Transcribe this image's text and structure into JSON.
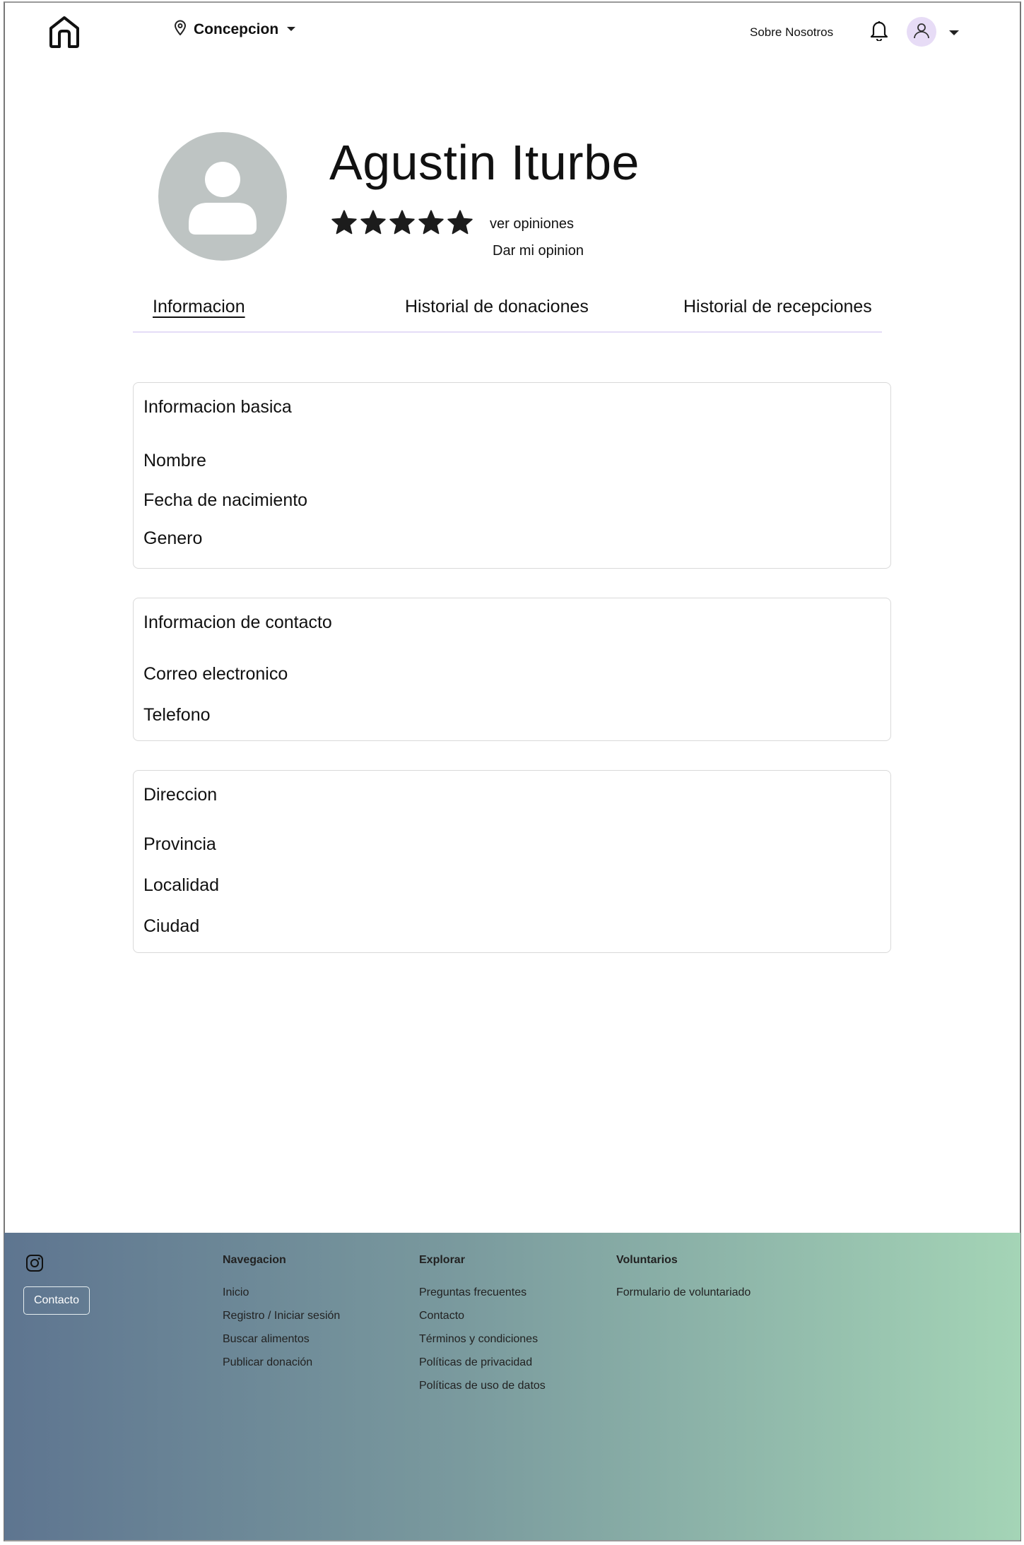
{
  "header": {
    "location": "Concepcion",
    "about_link": "Sobre Nosotros"
  },
  "profile": {
    "name": "Agustin Iturbe",
    "rating": 5,
    "rating_max": 5,
    "see_reviews": "ver opiniones",
    "give_review": "Dar mi opinion"
  },
  "tabs": [
    {
      "label": "Informacion",
      "active": true
    },
    {
      "label": "Historial de donaciones",
      "active": false
    },
    {
      "label": "Historial de recepciones",
      "active": false
    }
  ],
  "cards": {
    "basic": {
      "title": "Informacion basica",
      "fields": [
        "Nombre",
        "Fecha de nacimiento",
        "Genero"
      ]
    },
    "contact": {
      "title": "Informacion de contacto",
      "fields": [
        "Correo electronico",
        "Telefono"
      ]
    },
    "address": {
      "title": "Direccion",
      "fields": [
        "Provincia",
        "Localidad",
        "Ciudad"
      ]
    }
  },
  "footer": {
    "contact_button": "Contacto",
    "columns": [
      {
        "title": "Navegacion",
        "links": [
          "Inicio",
          "Registro / Iniciar sesión",
          "Buscar alimentos",
          "Publicar donación"
        ]
      },
      {
        "title": "Explorar",
        "links": [
          "Preguntas frecuentes",
          "Contacto",
          "Términos y condiciones",
          "Políticas de privacidad",
          "Políticas de uso de datos"
        ]
      },
      {
        "title": "Voluntarios",
        "links": [
          "Formulario de voluntariado"
        ]
      }
    ]
  },
  "colors": {
    "avatar_bg": "#bec4c3",
    "avatar_small_bg": "#e7dcf6",
    "tab_line": "#e4dcf7",
    "footer_gradient_start": "#5e7590",
    "footer_gradient_end": "#a4d4b6"
  },
  "icons": [
    "home-icon",
    "location-pin-icon",
    "chevron-down-icon",
    "bell-icon",
    "user-icon",
    "star-icon",
    "instagram-icon"
  ]
}
